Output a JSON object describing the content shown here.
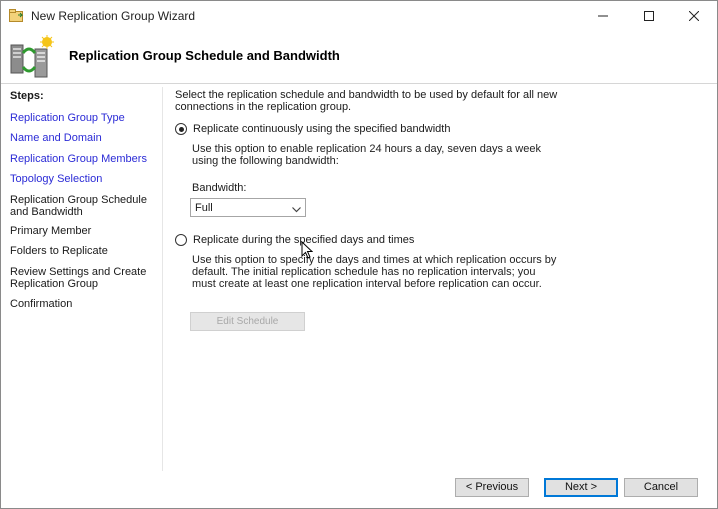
{
  "window": {
    "title": "New Replication Group Wizard"
  },
  "header": {
    "title": "Replication Group Schedule and Bandwidth"
  },
  "steps": {
    "heading": "Steps:",
    "items": [
      {
        "label": "Replication Group Type",
        "state": "link"
      },
      {
        "label": "Name and Domain",
        "state": "link"
      },
      {
        "label": "Replication Group Members",
        "state": "link"
      },
      {
        "label": "Topology Selection",
        "state": "link"
      },
      {
        "label": "Replication Group Schedule and Bandwidth",
        "state": "current"
      },
      {
        "label": "Primary Member",
        "state": "pending"
      },
      {
        "label": "Folders to Replicate",
        "state": "pending"
      },
      {
        "label": "Review Settings and Create Replication Group",
        "state": "pending"
      },
      {
        "label": "Confirmation",
        "state": "pending"
      }
    ]
  },
  "main": {
    "description": "Select the replication schedule and bandwidth to be used by default for all new connections in the replication group.",
    "option_continuous": {
      "label": "Replicate continuously using the specified bandwidth",
      "info": "Use this option to enable replication 24 hours a day, seven days a week using the following bandwidth:",
      "checked": true
    },
    "bandwidth": {
      "label": "Bandwidth:",
      "value": "Full"
    },
    "option_scheduled": {
      "label": "Replicate during the specified days and times",
      "info": "Use this option to specify the days and times at which replication occurs by default. The initial replication schedule has no replication intervals; you must create at least one replication interval before replication can occur.",
      "checked": false
    },
    "edit_schedule_label": "Edit Schedule"
  },
  "footer": {
    "previous_label": "< Previous",
    "next_label": "Next >",
    "cancel_label": "Cancel"
  },
  "colors": {
    "link": "#2b2bd6",
    "accent": "#0078d7"
  },
  "icons": {
    "app": "replication-wizard-icon",
    "header": "server-replication-icon"
  }
}
